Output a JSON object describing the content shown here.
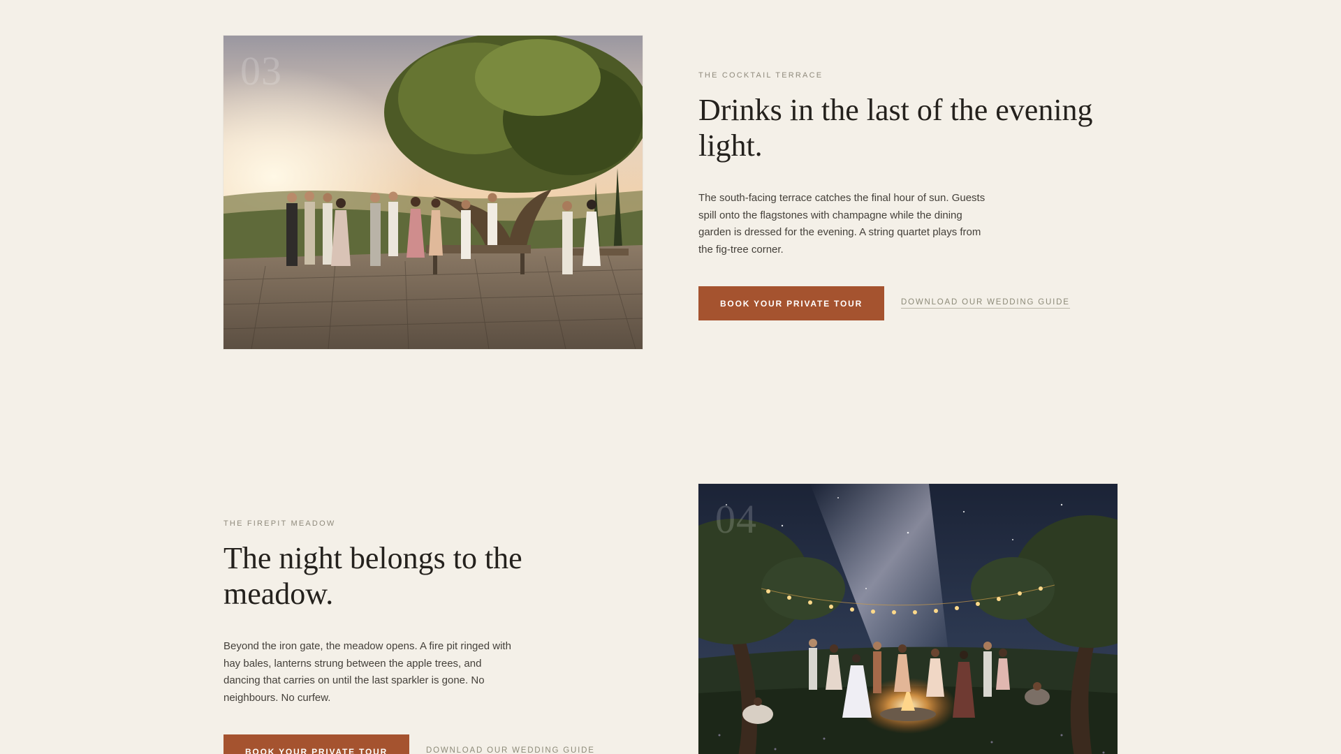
{
  "sections": [
    {
      "number": "03",
      "eyebrow": "THE COCKTAIL TERRACE",
      "headline": "Drinks in the last of the evening light.",
      "body": "The south-facing terrace catches the final hour of sun. Guests spill onto the flagstones with champagne while the dining garden is dressed for the evening. A string quartet plays from the fig-tree corner.",
      "primary_cta": "BOOK YOUR PRIVATE TOUR",
      "secondary_cta": "DOWNLOAD OUR WEDDING GUIDE"
    },
    {
      "number": "04",
      "eyebrow": "THE FIREPIT MEADOW",
      "headline": "The night belongs to the meadow.",
      "body": "Beyond the iron gate, the meadow opens. A fire pit ringed with hay bales, lanterns strung between the apple trees, and dancing that carries on until the last sparkler is gone. No neighbours. No curfew.",
      "primary_cta": "BOOK YOUR PRIVATE TOUR",
      "secondary_cta": "DOWNLOAD OUR WEDDING GUIDE"
    }
  ],
  "colors": {
    "background": "#f4f0e8",
    "accent": "#a5532f",
    "heading": "#24211d",
    "muted": "#8f8a7c"
  }
}
